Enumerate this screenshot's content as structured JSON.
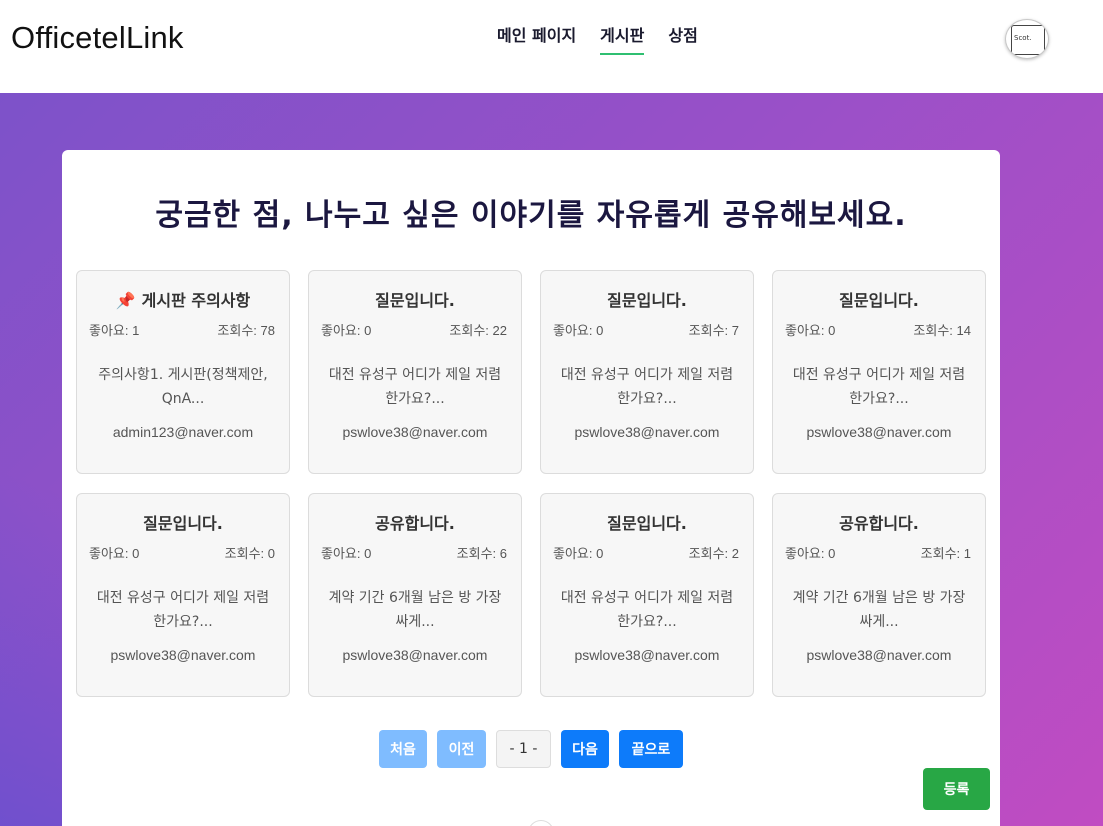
{
  "header": {
    "logo": "OfficetelLink",
    "nav": [
      {
        "label": "메인 페이지",
        "active": false
      },
      {
        "label": "게시판",
        "active": true
      },
      {
        "label": "상점",
        "active": false
      }
    ],
    "avatar_text": "Scot."
  },
  "main": {
    "title": "궁금한 점, 나누고 싶은 이야기를 자유롭게 공유해보세요."
  },
  "posts": [
    {
      "title": "게시판 주의사항",
      "pinned": true,
      "likes": "좋아요: 1",
      "views": "조회수: 78",
      "preview": "주의사항1. 게시판(정책제안, QnA...",
      "author": "admin123@naver.com"
    },
    {
      "title": "질문입니다.",
      "pinned": false,
      "likes": "좋아요: 0",
      "views": "조회수: 22",
      "preview": "대전 유성구 어디가 제일 저렴한가요?...",
      "author": "pswlove38@naver.com"
    },
    {
      "title": "질문입니다.",
      "pinned": false,
      "likes": "좋아요: 0",
      "views": "조회수: 7",
      "preview": "대전 유성구 어디가 제일 저렴한가요?...",
      "author": "pswlove38@naver.com"
    },
    {
      "title": "질문입니다.",
      "pinned": false,
      "likes": "좋아요: 0",
      "views": "조회수: 14",
      "preview": "대전 유성구 어디가 제일 저렴한가요?...",
      "author": "pswlove38@naver.com"
    },
    {
      "title": "질문입니다.",
      "pinned": false,
      "likes": "좋아요: 0",
      "views": "조회수: 0",
      "preview": "대전 유성구 어디가 제일 저렴한가요?...",
      "author": "pswlove38@naver.com"
    },
    {
      "title": "공유합니다.",
      "pinned": false,
      "likes": "좋아요: 0",
      "views": "조회수: 6",
      "preview": "계약 기간 6개월 남은 방 가장 싸게...",
      "author": "pswlove38@naver.com"
    },
    {
      "title": "질문입니다.",
      "pinned": false,
      "likes": "좋아요: 0",
      "views": "조회수: 2",
      "preview": "대전 유성구 어디가 제일 저렴한가요?...",
      "author": "pswlove38@naver.com"
    },
    {
      "title": "공유합니다.",
      "pinned": false,
      "likes": "좋아요: 0",
      "views": "조회수: 1",
      "preview": "계약 기간 6개월 남은 방 가장 싸게...",
      "author": "pswlove38@naver.com"
    }
  ],
  "pagination": {
    "first": "처음",
    "prev": "이전",
    "current": "- 1 -",
    "next": "다음",
    "last": "끝으로"
  },
  "register_label": "등록",
  "colors": {
    "nav_active_underline": "#2fbf71",
    "gradient_start": "#7d52c9",
    "gradient_end": "#c04cc2",
    "primary_button": "#0d7bfa",
    "disabled_button": "#7fbcff",
    "register_button": "#28a745"
  }
}
